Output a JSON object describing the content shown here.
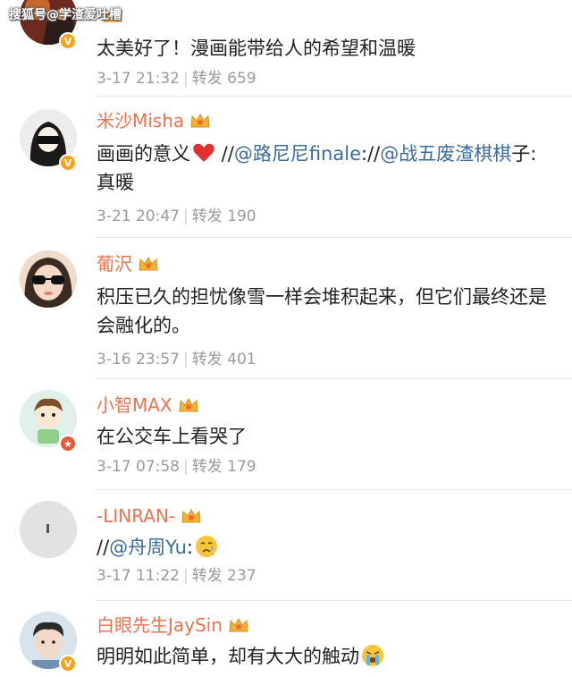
{
  "watermark": "搜狐号@学渣爱吐槽",
  "colors": {
    "name": "#eb7350",
    "mention": "#3c6b9e",
    "meta": "#9a9a9a",
    "badge": "#f7a21b"
  },
  "comments": [
    {
      "name": "",
      "text": "太美好了！漫画能带给人的希望和温暖",
      "date": "3-17 21:32",
      "repost_label": "转发",
      "repost_count": "659",
      "verified": true,
      "crown": true,
      "avatar_icon": "dark-illustration-avatar"
    },
    {
      "name": "米沙Misha",
      "text_plain_1": "画画的意义",
      "text_sep_1": " //",
      "mention_1": "@路尼尼finale",
      "text_sep_2": "://",
      "mention_2": "@战五废渣棋棋",
      "text_plain_2": "子: 真暖",
      "date": "3-21 20:47",
      "repost_label": "转发",
      "repost_count": "190",
      "verified": true,
      "crown": true,
      "emoji_icon": "red-heart-icon",
      "avatar_icon": "girl-mask-avatar"
    },
    {
      "name": "葡沢",
      "text": "积压已久的担忧像雪一样会堆积起来，但它们最终还是会融化的。",
      "date": "3-16 23:57",
      "repost_label": "转发",
      "repost_count": "401",
      "verified": false,
      "crown": true,
      "avatar_icon": "sunglasses-girl-avatar"
    },
    {
      "name": "小智MAX",
      "text": "在公交车上看哭了",
      "date": "3-17 07:58",
      "repost_label": "转发",
      "repost_count": "179",
      "verified": true,
      "crown": true,
      "avatar_icon": "cartoon-boy-avatar"
    },
    {
      "name": "-LINRAN-",
      "text_sep_1": "//",
      "mention_1": "@舟周Yu",
      "text_plain_1": ":",
      "date": "3-17 11:22",
      "repost_label": "转发",
      "repost_count": "237",
      "verified": false,
      "crown": true,
      "emoji_icon": "crying-face-icon",
      "avatar_icon": "plain-grey-avatar"
    },
    {
      "name": "白眼先生JaySin",
      "text": "明明如此简单，却有大大的触动",
      "verified": true,
      "crown": true,
      "emoji_icon": "loud-crying-face-icon",
      "avatar_icon": "young-man-avatar"
    }
  ]
}
